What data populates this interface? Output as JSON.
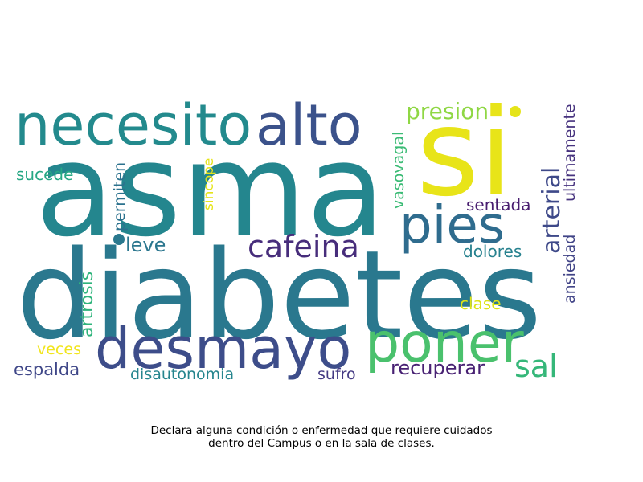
{
  "words": [
    {
      "text": "asma",
      "color": "#24868e",
      "rotate": false
    },
    {
      "text": "diabetes",
      "color": "#2a788e",
      "rotate": false
    },
    {
      "text": "si",
      "color": "#e8e419",
      "rotate": false
    },
    {
      "text": "necesito",
      "color": "#238a8d",
      "rotate": false
    },
    {
      "text": "alto",
      "color": "#3b528b",
      "rotate": false
    },
    {
      "text": "desmayo",
      "color": "#3d4d8a",
      "rotate": false
    },
    {
      "text": "poner",
      "color": "#4ac16d",
      "rotate": false
    },
    {
      "text": "pies",
      "color": "#2f6c8e",
      "rotate": false
    },
    {
      "text": "cafeina",
      "color": "#472d7b",
      "rotate": false
    },
    {
      "text": "presion",
      "color": "#8fd744",
      "rotate": false
    },
    {
      "text": "sal",
      "color": "#35b779",
      "rotate": false
    },
    {
      "text": "arterial",
      "color": "#3e4989",
      "rotate": true
    },
    {
      "text": "ultimamente",
      "color": "#46327e",
      "rotate": true
    },
    {
      "text": "ansiedad",
      "color": "#414487",
      "rotate": true
    },
    {
      "text": "vasovagal",
      "color": "#3bbb75",
      "rotate": true
    },
    {
      "text": "artrosis",
      "color": "#2fb47c",
      "rotate": true
    },
    {
      "text": "permiten",
      "color": "#2c728e",
      "rotate": true
    },
    {
      "text": "sincope",
      "color": "#e5e419",
      "rotate": true
    },
    {
      "text": "sucede",
      "color": "#26a784",
      "rotate": false
    },
    {
      "text": "leve",
      "color": "#2a768e",
      "rotate": false
    },
    {
      "text": "sentada",
      "color": "#481d6f",
      "rotate": false
    },
    {
      "text": "dolores",
      "color": "#26818e",
      "rotate": false
    },
    {
      "text": "clase",
      "color": "#dde318",
      "rotate": false
    },
    {
      "text": "recuperar",
      "color": "#482173",
      "rotate": false
    },
    {
      "text": "veces",
      "color": "#f1e51d",
      "rotate": false
    },
    {
      "text": "espalda",
      "color": "#3f4788",
      "rotate": false
    },
    {
      "text": "disautonomia",
      "color": "#25858e",
      "rotate": false
    },
    {
      "text": "sufro",
      "color": "#443a83",
      "rotate": false
    }
  ],
  "caption": {
    "line1": "Declara alguna condición o enfermedad que requiere cuidados",
    "line2": "dentro del Campus o en la sala de clases."
  }
}
